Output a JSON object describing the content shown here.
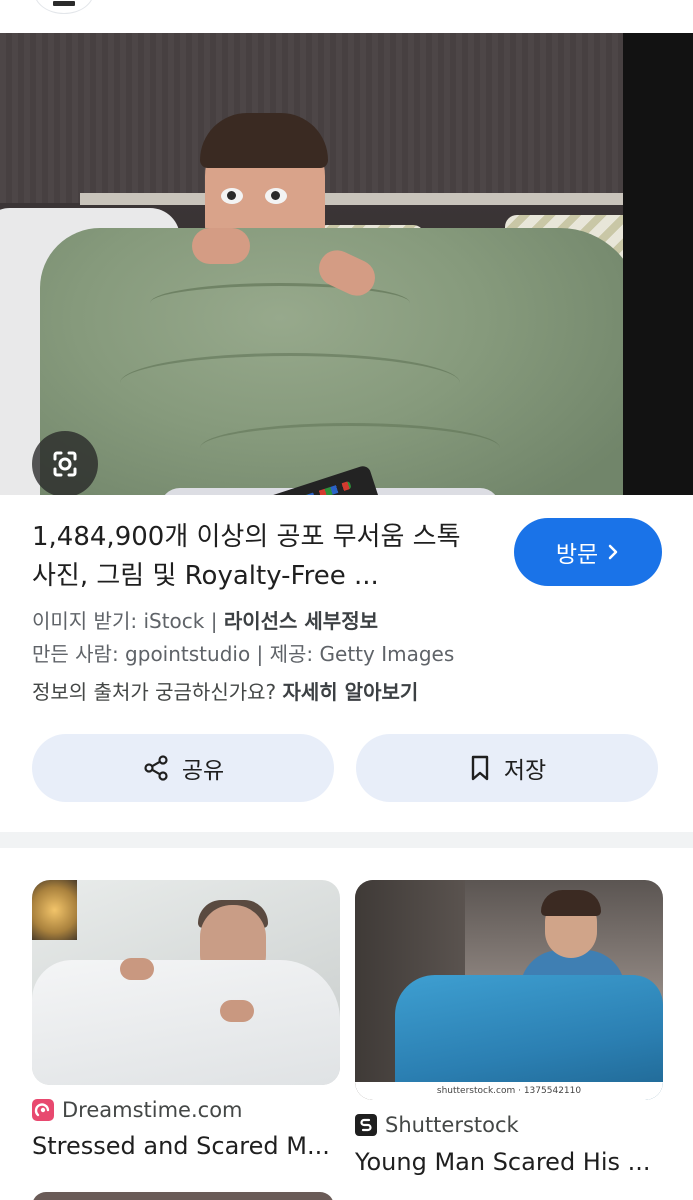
{
  "result": {
    "title": "1,484,900개 이상의 공포 무서움 스톡 사진, 그림 및 Royalty-Free ...",
    "visit_label": "방문",
    "meta": {
      "source_prefix": "이미지 받기: iStock | ",
      "license_link": "라이선스 세부정보",
      "creator_line": "만든 사람: gpointstudio | 제공: Getty Images",
      "source_question": "정보의 출처가 궁금하신가요? ",
      "learn_more": "자세히 알아보기"
    },
    "share_label": "공유",
    "save_label": "저장"
  },
  "related": [
    {
      "source": "Dreamstime.com",
      "title": "Stressed and Scared M..."
    },
    {
      "source": "Shutterstock",
      "title": "Young Man Scared His ...",
      "watermark": "shutterstock.com · 1375542110"
    }
  ],
  "colors": {
    "accent": "#1a73e8",
    "button_bg": "#e8eef9",
    "divider": "#f1f3f4"
  },
  "icons": [
    "lens-icon",
    "chevron-right-icon",
    "share-icon",
    "bookmark-icon",
    "dreamstime-icon",
    "shutterstock-icon"
  ]
}
